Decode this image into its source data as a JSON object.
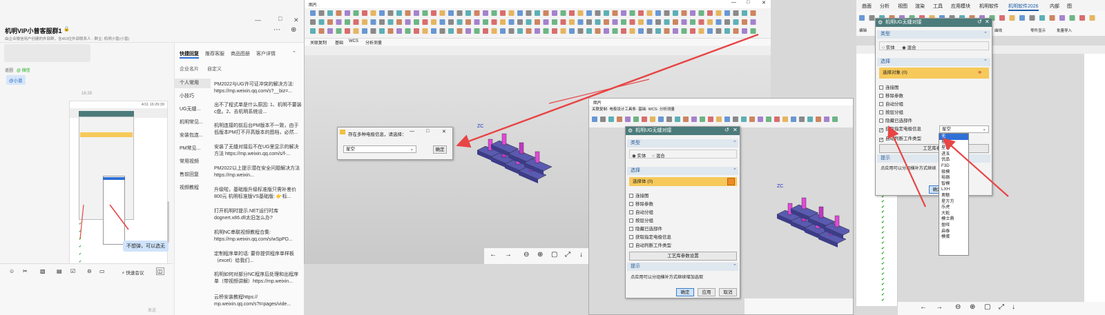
{
  "chat": {
    "group_title": "机明VIP小曾客服群1",
    "group_subtitle": "由企业微信用户创建的外部群，含453位外部联系人 · 群主: 机明小曾(小曾)",
    "invite_label": "遥圈",
    "wechat_label": "@ 微信",
    "mention_chip": "@小曾",
    "time_1": "16:29",
    "thumb_time": "4/11 16:29:39",
    "reply_bubble": "不想弹，可以选无",
    "input_placeholder": "发送",
    "quick_meeting": "快速会议",
    "win_controls": [
      "—",
      "□",
      "✕"
    ],
    "more": "⋯",
    "add": "⊕"
  },
  "quick_reply": {
    "tabs": [
      "快捷回复",
      "推荐客服",
      "商品图册",
      "客户详情"
    ],
    "subtabs": [
      "企业名片",
      "自定义"
    ],
    "categories": [
      "个人常用",
      "小技巧",
      "UG无缝...",
      "机明常见...",
      "安装包连...",
      "PM常见...",
      "常用视频",
      "售前回复",
      "视频教程"
    ],
    "items": [
      "PM2022与UG许可证冲突的解决方法: https://mp.weixin.qq.com/s?__biz=...",
      "出不了程式单是什么原因: 1、机明不要装c盘。2、去机明系统设...",
      "机明连接的前后台PM版本不一致，由于低版本PM打不开高版本的图档，必然...",
      "安装了无缝对接后不在UG里显示的解决方法 https://mp.weixin.qq.com/s/f-...",
      "PM2022以上提示潜在安全问题解决方法 https://mp.weixin...",
      "升级啦，基础版升级标准版只需补差价800元 机明标准版VS基础版: 👉标...",
      "打开机明时提示.NET运行时库dognert.x86.dll太旧怎么办?",
      "机明NC串联视频教程合集: https://mp.weixin.qq.com/s/wSpPD...",
      "定制程序单的话: 要你提供程序单样板（excel）给我们...",
      "机明如何对部分NC程序后处理和出程序单（带视频讲解）https://mp.weixin...",
      "云桥安装教程https:// mp.weixin.qq.com/s?t=pages/vide..."
    ]
  },
  "nx": {
    "window_title": "图片",
    "dialog_title": "存在多种电极信息，请选择：",
    "select_value": "星空",
    "ok": "确定",
    "win_controls": [
      "—",
      "□",
      "✕"
    ],
    "menu_items": [
      "关联复制",
      "基础",
      "WCS",
      "分析测量"
    ],
    "axis_label": "ZC",
    "viewer_controls": [
      "←",
      "→",
      "⊖",
      "⊕",
      "▢",
      "⤢",
      "↓"
    ]
  },
  "nx2": {
    "window_title": "图片",
    "menu_items": [
      "关联复制",
      "电极设计工具条",
      "关联复制",
      "基础",
      "WCS",
      "分析测量"
    ],
    "dialog_title": "机明UG无缝对接",
    "type_header": "类型",
    "type_solid": "实体",
    "type_mixed": "混合",
    "select_header": "选择",
    "select_row": "选择体 (0)",
    "options": [
      "连接图",
      "移除参数",
      "自动分组",
      "按层分组",
      "隐藏已选部件",
      "获取指定电极信息",
      "自动判断工件类型"
    ],
    "param_button": "工艺库参数设置",
    "hint_header": "提示",
    "hint_text": "点应用可以分组横补方式继续增加选取",
    "ok": "确定",
    "apply": "应用",
    "cancel": "取消",
    "axis_label": "ZC",
    "win_controls": [
      "—",
      "□",
      "✕"
    ]
  },
  "nx3": {
    "ribbon_tabs": [
      "曲面",
      "分析",
      "视图",
      "渲染",
      "工具",
      "应用模块",
      "机明软件",
      "机明软件2026",
      "内部",
      "图"
    ],
    "ribbon_sub": [
      "编辑",
      "曲线",
      "零件显示",
      "批量导入"
    ],
    "dialog_title": "机明UG无缝对接",
    "type_header": "类型",
    "type_solid": "实体",
    "type_mixed": "混合",
    "select_header": "选择",
    "select_row": "选择对象 (0)",
    "options": [
      "连接图",
      "移除参数",
      "自动分组",
      "按层分组",
      "隐藏已选部件",
      "获取指定电极信息",
      "自动判断工件类型"
    ],
    "param_button": "工艺库参数",
    "hint_header": "提示",
    "hint_text": "点应用可以分组横补方式继续",
    "ok": "确定",
    "dropdown_value": "星空",
    "dropdown_options": [
      "无",
      "星空",
      "星剑",
      "进玉",
      "优品",
      "F3D",
      "极模",
      "裕器",
      "智模",
      "LXH",
      "奥魅",
      "星方方",
      "乐虎",
      "大乾",
      "模士鼎",
      "盈旺",
      "启泰",
      "模蛋"
    ],
    "viewer_controls": [
      "←",
      "→",
      "⊖",
      "⊕",
      "▢",
      "⤢",
      "↓"
    ]
  },
  "colors": {
    "accent_arrow": "#e84545",
    "dialog_header": "#4b7b7a",
    "select_highlight": "#f6c95a",
    "dropdown_selected": "#2f6fd6",
    "check_green": "#0a9b0a"
  }
}
